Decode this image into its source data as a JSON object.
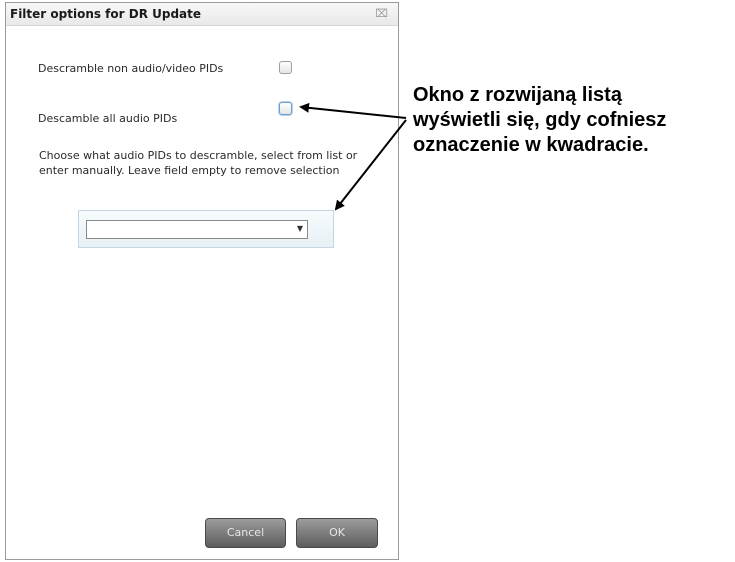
{
  "dialog": {
    "title": "Filter options for DR Update",
    "close_label": "⌧",
    "option1_label": "Descramble non audio/video PIDs",
    "option2_label": "Descamble all audio PIDs",
    "description": "Choose what audio PIDs to descramble, select from list or enter manually. Leave field empty to remove selection",
    "combo": {
      "value": "",
      "arrow": "▼"
    },
    "cancel_label": "Cancel",
    "ok_label": "OK"
  },
  "annotation": {
    "line1": "Okno z rozwijaną listą",
    "line2": "wyświetli się, gdy cofniesz",
    "line3": "oznaczenie w kwadracie."
  },
  "colors": {
    "button": "#5d5d5d",
    "focus": "#6f9fc8",
    "panel": "#e6f0f5"
  }
}
